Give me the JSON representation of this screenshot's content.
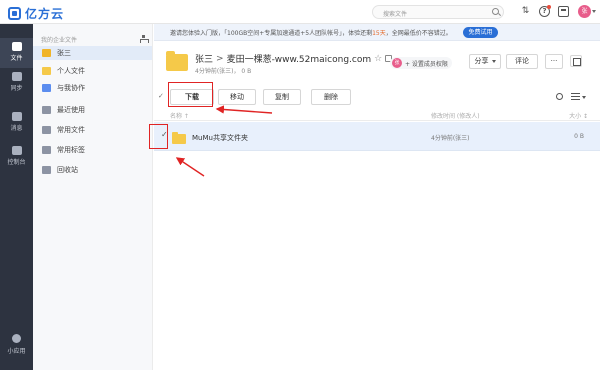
{
  "app": {
    "logo_text": "亿方云"
  },
  "topbar": {
    "search_placeholder": "搜索文件",
    "avatar_text": "张",
    "help_glyph": "?"
  },
  "leftnav": {
    "items": [
      {
        "label": "文件"
      },
      {
        "label": "同步"
      },
      {
        "label": "消息"
      },
      {
        "label": "控制台"
      }
    ],
    "bottom_label": "小应用"
  },
  "subnav": {
    "section_title": "我的企业文件",
    "items": [
      {
        "label": "张三",
        "icon": "user-folder-icon",
        "color": "#f0b429"
      },
      {
        "label": "个人文件",
        "icon": "personal-folder-icon",
        "color": "#f5c949"
      },
      {
        "label": "与我协作",
        "icon": "collab-icon",
        "color": "#5b8def"
      },
      {
        "label": "最近使用",
        "icon": "recent-icon",
        "color": "#8c93a3"
      },
      {
        "label": "常用文件",
        "icon": "favorite-file-icon",
        "color": "#8c93a3"
      },
      {
        "label": "常用标签",
        "icon": "tag-icon",
        "color": "#8c93a3"
      },
      {
        "label": "回收站",
        "icon": "trash-icon",
        "color": "#8c93a3"
      }
    ]
  },
  "notice": {
    "text_prefix": "邀请您体验入门版，「100GB空间+专属加速通道+5人团队帐号」，体验还剩",
    "days": "15天",
    "text_suffix": "，全网最低价不容错过。",
    "button_label": "免费试用"
  },
  "folder": {
    "crumb_parent": "张三",
    "crumb_sep": ">",
    "crumb_current": "麦田一棵葱-www.52maicong.com",
    "star_glyph": "☆",
    "meta": "4分钟前(张三)， 0 B",
    "perm_avatar": "张",
    "perm_label": "+ 设置成员权限",
    "share_label": "分享",
    "comment_label": "评论",
    "more_label": "···"
  },
  "toolbar": {
    "select_all_glyph": "✓",
    "download_label": "下载",
    "move_label": "移动",
    "copy_label": "复制",
    "delete_label": "删除"
  },
  "list": {
    "headers": {
      "name": "名称 ↑",
      "modified": "修改时间 (修改人)",
      "size": "大小 ↕"
    },
    "rows": [
      {
        "check": "✓",
        "name": "MuMu共享文件夹",
        "modified": "4分钟前(张三)",
        "size": "0 B"
      }
    ]
  },
  "colors": {
    "accent": "#2a6fd6",
    "annotation": "#e02424",
    "folder": "#f5c949",
    "nav_bg": "#2d3340"
  }
}
